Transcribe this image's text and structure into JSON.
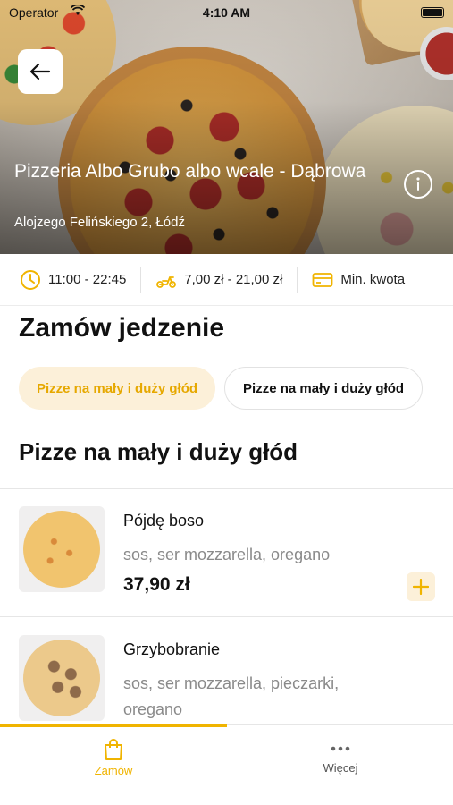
{
  "status_bar": {
    "carrier": "Operator",
    "time": "4:10 AM"
  },
  "restaurant": {
    "name": "Pizzeria Albo Grubo albo wcale - Dąbrowa",
    "address": "Alojzego Felińskiego 2, Łódź"
  },
  "info_strip": {
    "hours": "11:00 - 22:45",
    "delivery_fee": "7,00 zł - 21,00 zł",
    "min_order": "Min. kwota"
  },
  "order_section": {
    "title": "Zamów jedzenie"
  },
  "categories": [
    {
      "label": "Pizze na mały i duży głód",
      "selected": true
    },
    {
      "label": "Pizze na mały i duży głód",
      "selected": false
    }
  ],
  "current_category": {
    "title": "Pizze na mały i duży głód"
  },
  "products": [
    {
      "name": "Pójdę boso",
      "description": "sos, ser mozzarella, oregano",
      "price": "37,90 zł"
    },
    {
      "name": "Grzybobranie",
      "description": "sos, ser mozzarella, pieczarki, oregano"
    }
  ],
  "tabbar": {
    "items": [
      {
        "label": "Zamów",
        "icon": "shopping-bag-icon",
        "active": true
      },
      {
        "label": "Więcej",
        "icon": "more-dots-icon",
        "active": false
      }
    ]
  },
  "colors": {
    "accent": "#f0b400",
    "accent_soft": "#fcf0d9",
    "muted_text": "#8a8a8a"
  }
}
